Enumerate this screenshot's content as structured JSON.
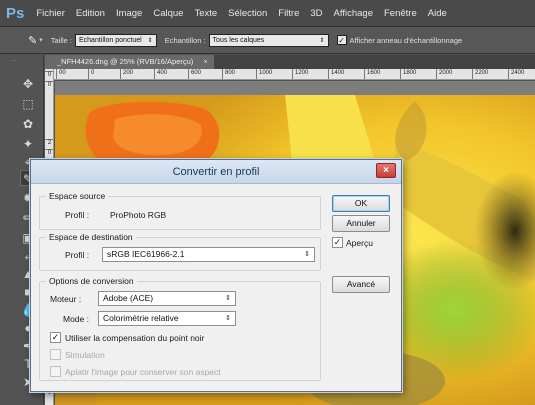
{
  "app": {
    "logo": "Ps",
    "menu": [
      "Fichier",
      "Edition",
      "Image",
      "Calque",
      "Texte",
      "Sélection",
      "Filtre",
      "3D",
      "Affichage",
      "Fenêtre",
      "Aide"
    ]
  },
  "options_bar": {
    "size_label": "Taille :",
    "size_value": "Echantillon ponctuel",
    "sample_label": "Echantillon :",
    "sample_value": "Tous les calques",
    "show_ring_label": "Afficher anneau d'échantillonnage",
    "show_ring_checked": true
  },
  "document": {
    "tab_title": "_NFH4426.dng @ 25% (RVB/16/Aperçu)",
    "tab_close": "×"
  },
  "rulers": {
    "horizontal": [
      "00",
      "0",
      "200",
      "400",
      "600",
      "800",
      "1000",
      "1200",
      "1400",
      "1600",
      "1800",
      "2000",
      "2200",
      "2400"
    ],
    "vertical": [
      "0",
      "0",
      "2",
      "0",
      "4",
      "0",
      "6"
    ]
  },
  "dialog": {
    "title": "Convertir en profil",
    "close": "×",
    "source": {
      "group_title": "Espace source",
      "profile_label": "Profil :",
      "profile_value": "ProPhoto RGB"
    },
    "destination": {
      "group_title": "Espace de destination",
      "profile_label": "Profil :",
      "profile_value": "sRGB IEC61966-2.1"
    },
    "conversion": {
      "group_title": "Options de conversion",
      "engine_label": "Moteur :",
      "engine_value": "Adobe (ACE)",
      "mode_label": "Mode :",
      "mode_value": "Colorimétrie relative",
      "black_point_label": "Utiliser la compensation du point noir",
      "black_point_checked": true,
      "simulation_label": "Simulation",
      "simulation_checked": false,
      "flatten_label": "Aplatir l'image pour conserver son aspect",
      "flatten_checked": false
    },
    "buttons": {
      "ok": "OK",
      "cancel": "Annuler",
      "advanced": "Avancé"
    },
    "preview_label": "Aperçu",
    "preview_checked": true
  },
  "colors": {
    "accent_blue": "#7ab8e8",
    "close_red": "#d9534a",
    "panel_dark": "#535353"
  }
}
